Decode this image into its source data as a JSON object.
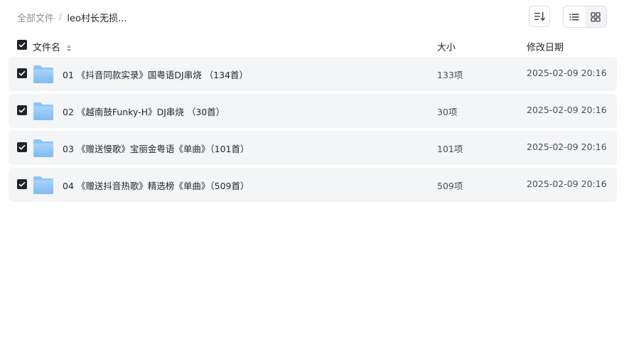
{
  "breadcrumb": {
    "root": "全部文件",
    "separator": "/",
    "current": "leo村长无损..."
  },
  "toolbar": {
    "sort_icon": "sort-icon",
    "view_list_icon": "list-view-icon",
    "view_grid_icon": "grid-view-icon"
  },
  "table": {
    "columns": {
      "name": "文件名",
      "size": "大小",
      "modified": "修改日期"
    },
    "rows": [
      {
        "name": "01 《抖音同款实录》国粤语DJ串烧 （134首）",
        "size": "133项",
        "modified": "2025-02-09 20:16",
        "checked": true
      },
      {
        "name": "02 《越南鼓Funky-H》DJ串烧 （30首）",
        "size": "30项",
        "modified": "2025-02-09 20:16",
        "checked": true
      },
      {
        "name": "03 《赠送慢歌》宝丽金粤语《单曲》（101首）",
        "size": "101项",
        "modified": "2025-02-09 20:16",
        "checked": true
      },
      {
        "name": "04 《赠送抖音热歌》精选榜《单曲》（509首）",
        "size": "509项",
        "modified": "2025-02-09 20:16",
        "checked": true
      }
    ]
  },
  "colors": {
    "row_bg": "#f4f5f6",
    "checkbox": "#1f2329",
    "folder": "#8cc3f5"
  }
}
